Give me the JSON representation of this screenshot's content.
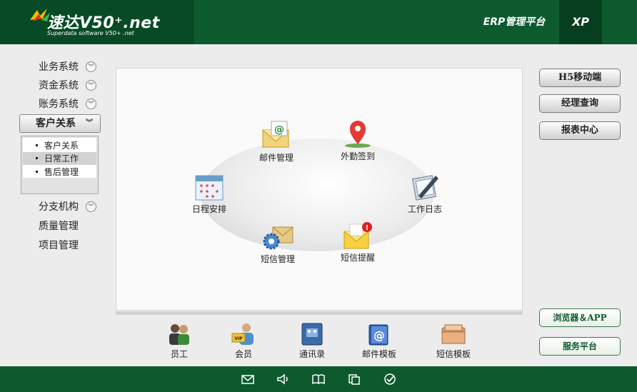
{
  "header": {
    "logo_title": "速达V50⁺.net",
    "logo_subtitle": "Superdata software V50+ .net",
    "platform": "ERP管理平台",
    "xp": "XP"
  },
  "leftnav": {
    "items": [
      {
        "label": "业务系统"
      },
      {
        "label": "资金系统"
      },
      {
        "label": "账务系统"
      },
      {
        "label": "客户关系"
      },
      {
        "label": "分支机构"
      },
      {
        "label": "质量管理"
      },
      {
        "label": "项目管理"
      }
    ],
    "submenu": [
      {
        "label": "客户关系"
      },
      {
        "label": "日常工作"
      },
      {
        "label": "售后管理"
      }
    ]
  },
  "features": {
    "mail": "邮件管理",
    "checkin": "外勤签到",
    "schedule": "日程安排",
    "worklog": "工作日志",
    "sms": "短信管理",
    "reminder": "短信提醒"
  },
  "tools": {
    "staff": "员工",
    "member": "会员",
    "contacts": "通讯录",
    "mail_template": "邮件模板",
    "sms_template": "短信模板"
  },
  "right_buttons": {
    "h5": "H5移动端",
    "manager": "经理查询",
    "report": "报表中心",
    "browser_app": "浏览器＆APP",
    "service": "服务平台"
  },
  "colors": {
    "brand_green": "#0d5a2f",
    "dark_green": "#074a25"
  },
  "footer_icons": [
    "mail-icon",
    "speaker-icon",
    "book-icon",
    "copy-icon",
    "check-icon"
  ]
}
